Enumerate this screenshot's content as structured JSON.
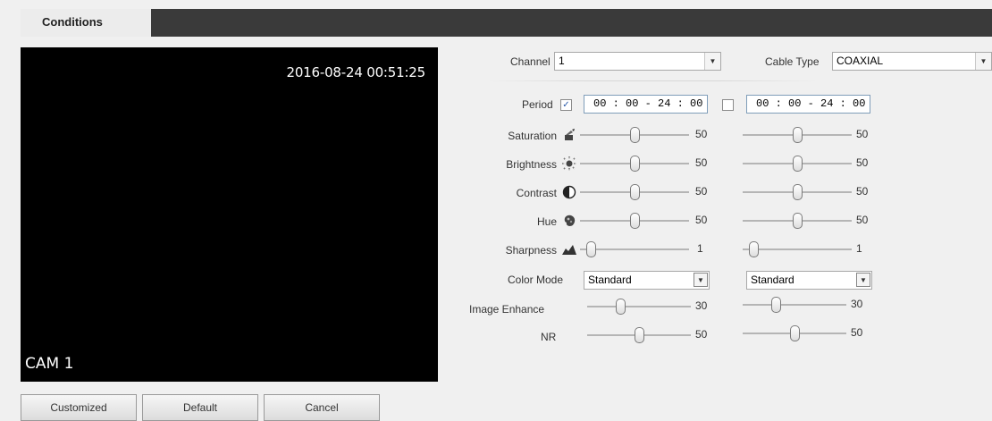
{
  "tabs": {
    "active": "Conditions"
  },
  "preview": {
    "timestamp": "2016-08-24 00:51:25",
    "camera_label": "CAM 1"
  },
  "buttons": {
    "customized": "Customized",
    "default": "Default",
    "cancel": "Cancel"
  },
  "channel": {
    "label": "Channel",
    "value": "1"
  },
  "cable_type": {
    "label": "Cable Type",
    "value": "COAXIAL"
  },
  "period": {
    "label": "Period",
    "profile1": {
      "checked": true,
      "check_glyph": "✓",
      "time": "00 : 00 - 24 : 00"
    },
    "profile2": {
      "checked": false,
      "time": "00 : 00 - 24 : 00"
    }
  },
  "sliders": [
    {
      "key": "saturation",
      "label": "Saturation",
      "icon": "saturation-icon",
      "p1": 50,
      "p2": 50,
      "max": 100
    },
    {
      "key": "brightness",
      "label": "Brightness",
      "icon": "brightness-icon",
      "p1": 50,
      "p2": 50,
      "max": 100
    },
    {
      "key": "contrast",
      "label": "Contrast",
      "icon": "contrast-icon",
      "p1": 50,
      "p2": 50,
      "max": 100
    },
    {
      "key": "hue",
      "label": "Hue",
      "icon": "hue-icon",
      "p1": 50,
      "p2": 50,
      "max": 100
    },
    {
      "key": "sharpness",
      "label": "Sharpness",
      "icon": "sharpness-icon",
      "p1": 1,
      "p2": 1,
      "max": 15
    }
  ],
  "color_mode": {
    "label": "Color Mode",
    "p1": "Standard",
    "p2": "Standard"
  },
  "image_enhance": {
    "label": "Image Enhance",
    "p1": 30,
    "p2": 30,
    "max": 100
  },
  "nr": {
    "label": "NR",
    "p1": 50,
    "p2": 50,
    "max": 100
  },
  "colors": {
    "tabbar": "#3a3a3a",
    "preview_bg": "#000000",
    "check_accent": "#2a5aa8"
  }
}
